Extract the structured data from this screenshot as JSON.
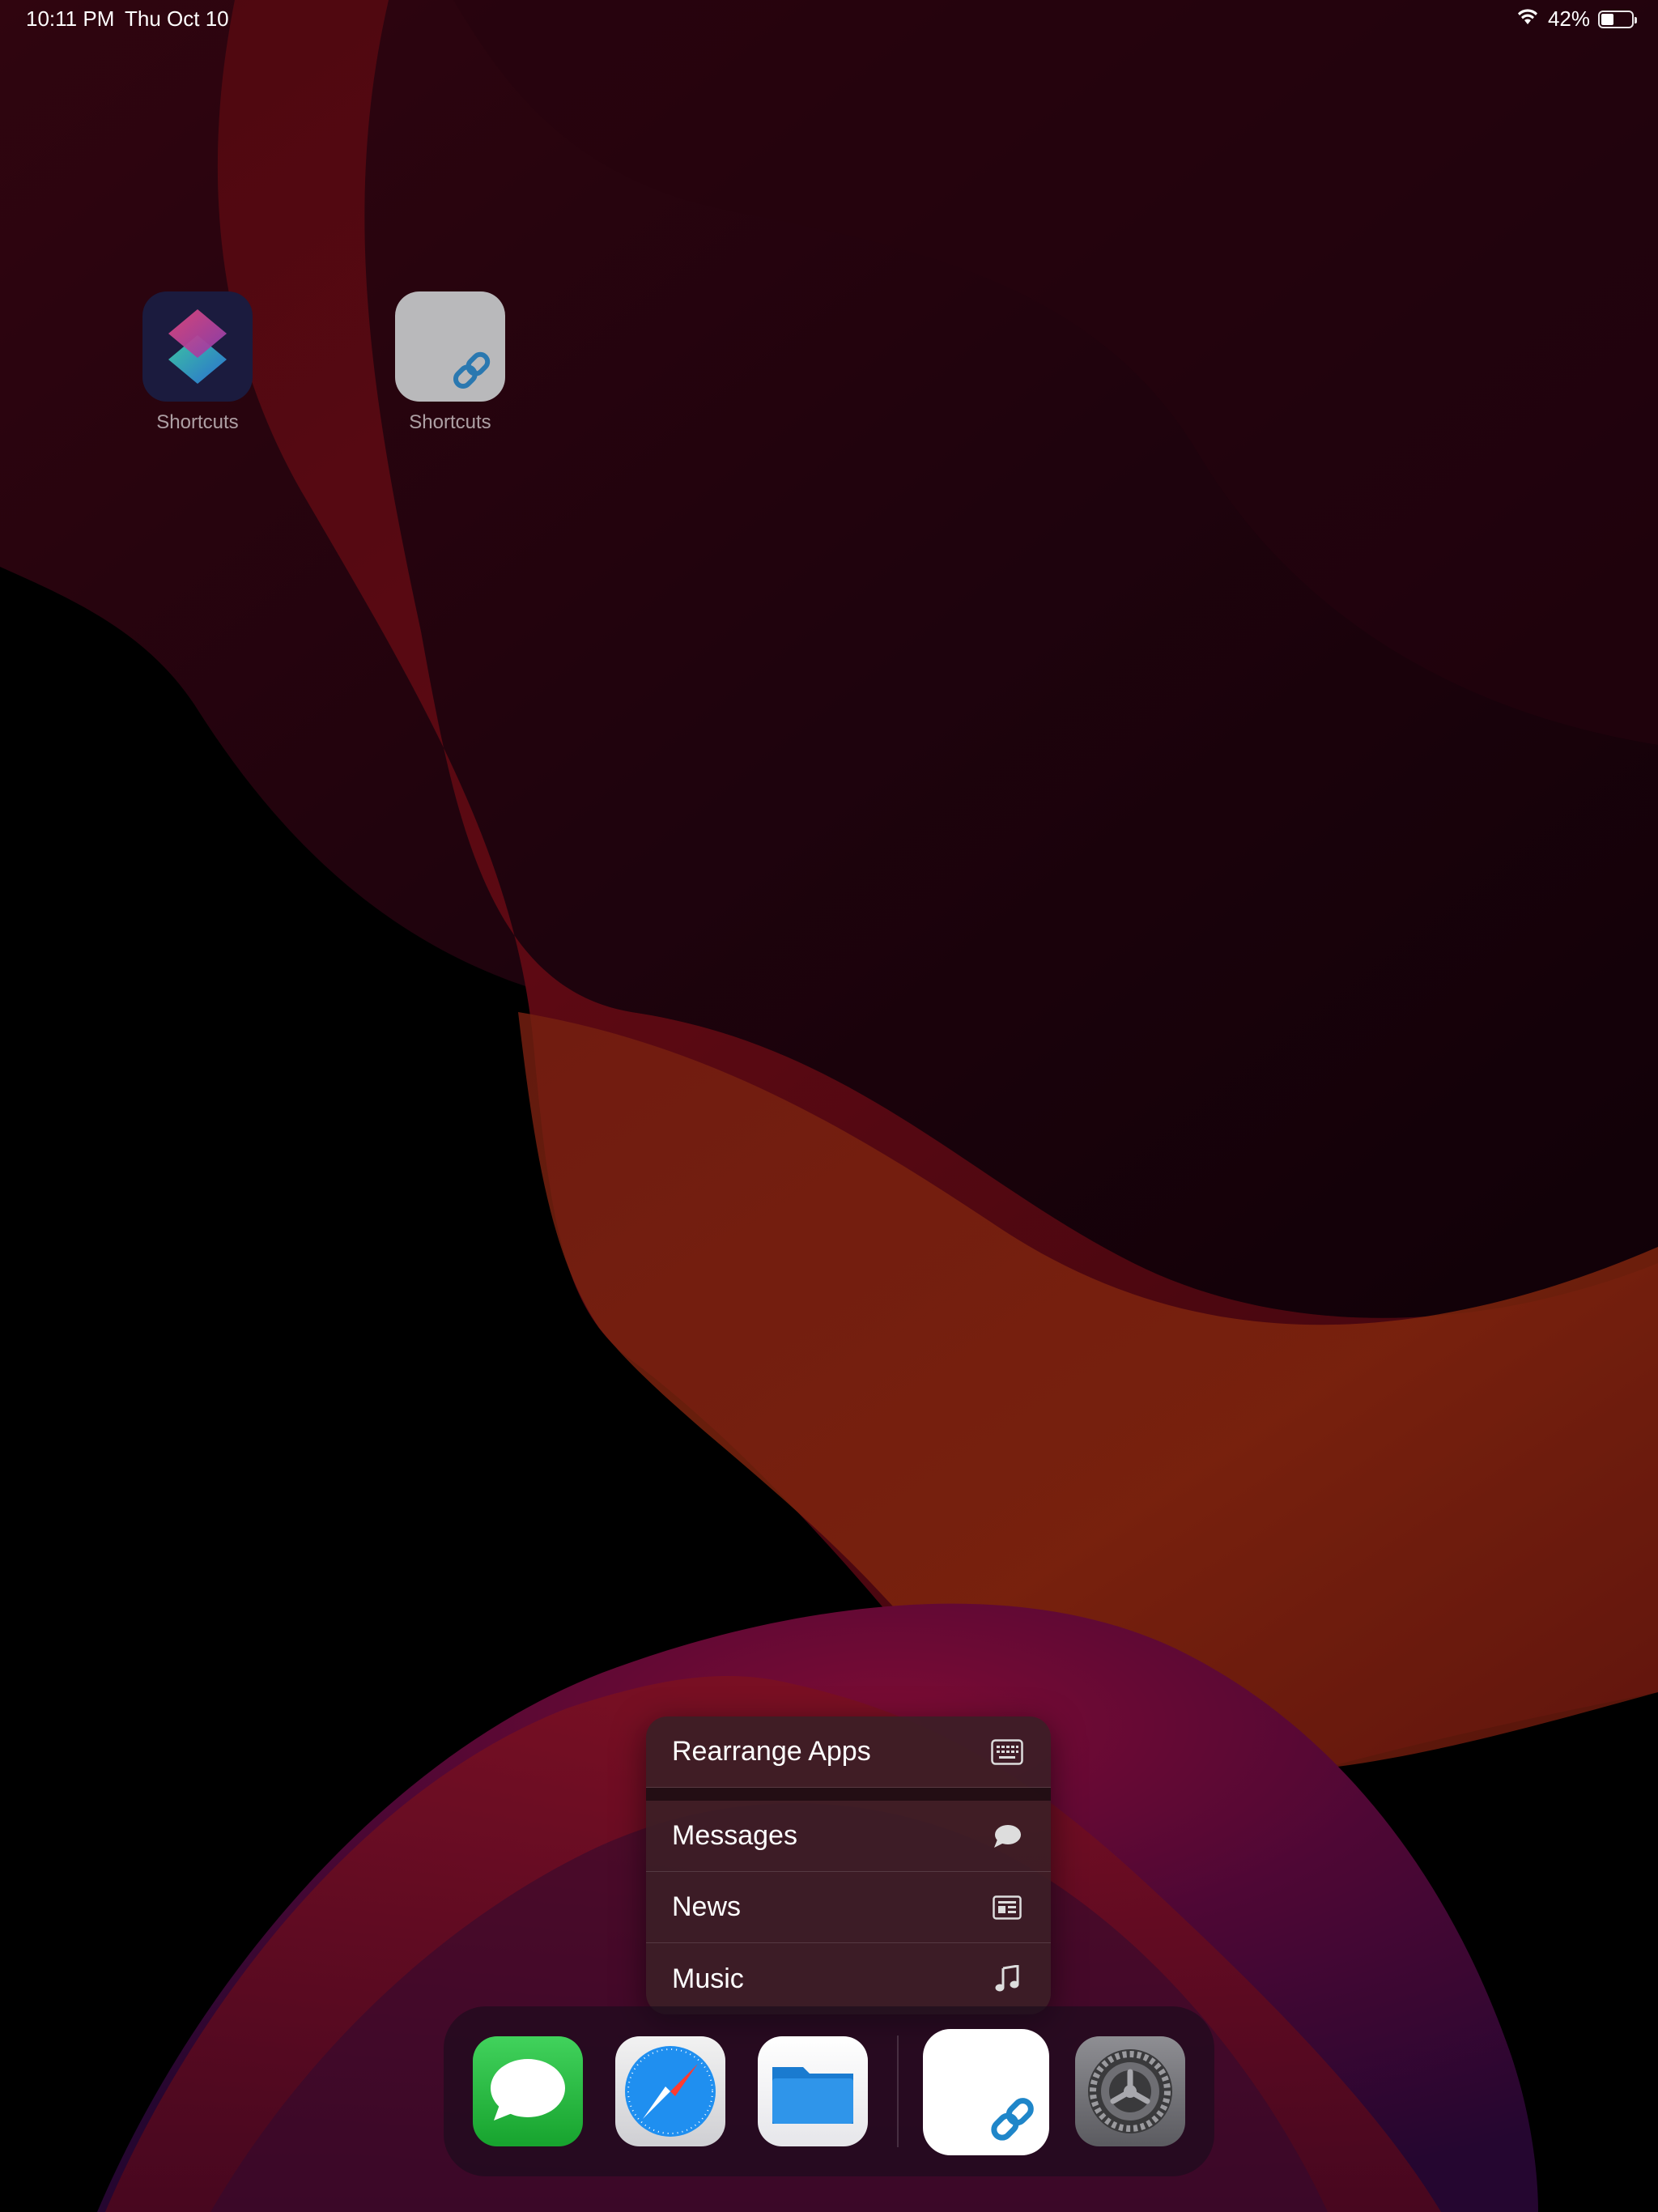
{
  "status_bar": {
    "time": "10:11 PM",
    "date": "Thu Oct 10",
    "battery_percent": "42%",
    "battery_level": 0.42
  },
  "home_apps": [
    {
      "label": "Shortcuts",
      "icon": "shortcuts-app-icon"
    },
    {
      "label": "Shortcuts",
      "icon": "shortcut-link-icon"
    }
  ],
  "context_menu": {
    "items": [
      {
        "label": "Rearrange Apps",
        "icon": "keyboard-icon"
      },
      {
        "label": "Messages",
        "icon": "speech-bubble-icon"
      },
      {
        "label": "News",
        "icon": "news-icon"
      },
      {
        "label": "Music",
        "icon": "music-note-icon"
      }
    ]
  },
  "dock": {
    "apps": [
      {
        "name": "Messages",
        "icon": "messages-app-icon"
      },
      {
        "name": "Safari",
        "icon": "safari-app-icon"
      },
      {
        "name": "Files",
        "icon": "files-app-icon"
      },
      {
        "name": "Shortcut",
        "icon": "shortcut-link-icon",
        "state": "pressed"
      },
      {
        "name": "Settings",
        "icon": "settings-app-icon"
      }
    ]
  },
  "colors": {
    "wallpaper_red": "#8a1c1c",
    "wallpaper_crimson": "#6e0f1e",
    "wallpaper_orange": "#b32a12",
    "wallpaper_magenta": "#a3104a",
    "menu_background": "#3c1e26",
    "link_blue": "#1f86c9"
  }
}
